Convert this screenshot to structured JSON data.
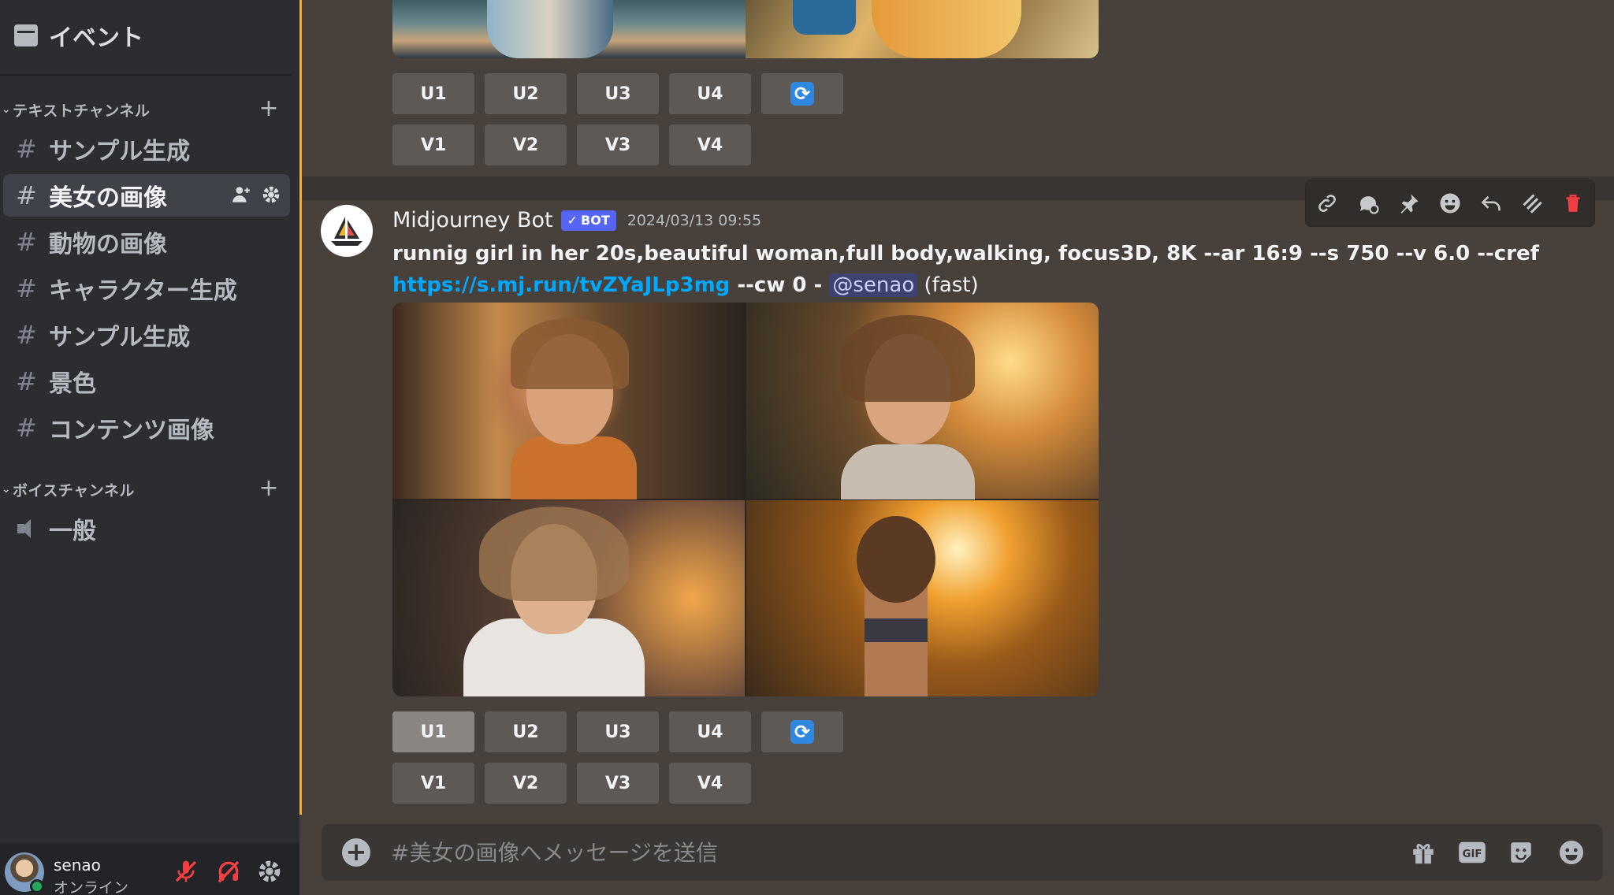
{
  "sidebar": {
    "events_label": "イベント",
    "text_category": "テキストチャンネル",
    "voice_category": "ボイスチャンネル",
    "channels": [
      {
        "name": "サンプル生成"
      },
      {
        "name": "美女の画像"
      },
      {
        "name": "動物の画像"
      },
      {
        "name": "キャラクター生成"
      },
      {
        "name": "サンプル生成"
      },
      {
        "name": "景色"
      },
      {
        "name": "コンテンツ画像"
      }
    ],
    "active_channel_index": 1,
    "voice_channels": [
      {
        "name": "一般"
      }
    ]
  },
  "user": {
    "name": "senao",
    "status": "オンライン"
  },
  "buttons": {
    "upscale": [
      "U1",
      "U2",
      "U3",
      "U4"
    ],
    "variation": [
      "V1",
      "V2",
      "V3",
      "V4"
    ]
  },
  "message": {
    "author": "Midjourney Bot",
    "bot_tag": "BOT",
    "timestamp": "2024/03/13 09:55",
    "prompt_bold": "runnig girl in her 20s,beautiful woman,full body,walking, focus3D, 8K --ar 16:9 --s 750 --v 6.0 --cref",
    "link": "https://s.mj.run/tvZYaJLp3mg",
    "suffix": " --cw 0 - ",
    "mention": "@senao",
    "speed": "(fast)"
  },
  "composer": {
    "placeholder": "#美女の画像へメッセージを送信"
  },
  "colors": {
    "accent_divider": "#f0b232",
    "link": "#00a8fc",
    "bot_tag": "#5865f2",
    "delete": "#f23f43",
    "reroll": "#2f88e0"
  }
}
